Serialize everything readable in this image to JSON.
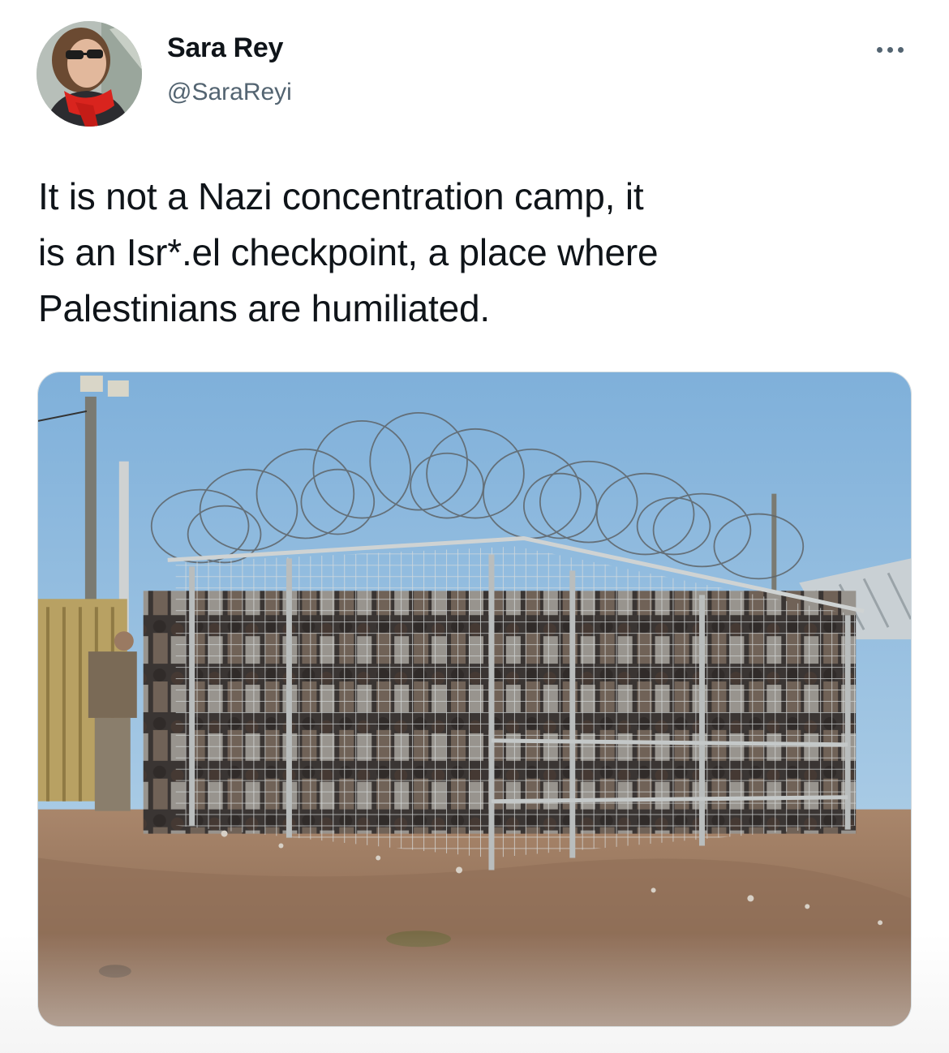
{
  "author": {
    "name": "Sara Rey",
    "handle": "@SaraReyi"
  },
  "tweet": {
    "text_lines": [
      "It is not a Nazi concentration camp, it",
      "is an Isr*.el checkpoint, a place where",
      "Palestinians are humiliated."
    ]
  },
  "icons": {
    "more": "more-horizontal-icon",
    "avatar": "user-avatar"
  },
  "colors": {
    "text": "#0f1419",
    "secondary_text": "#536471",
    "border": "#cfd9de"
  }
}
